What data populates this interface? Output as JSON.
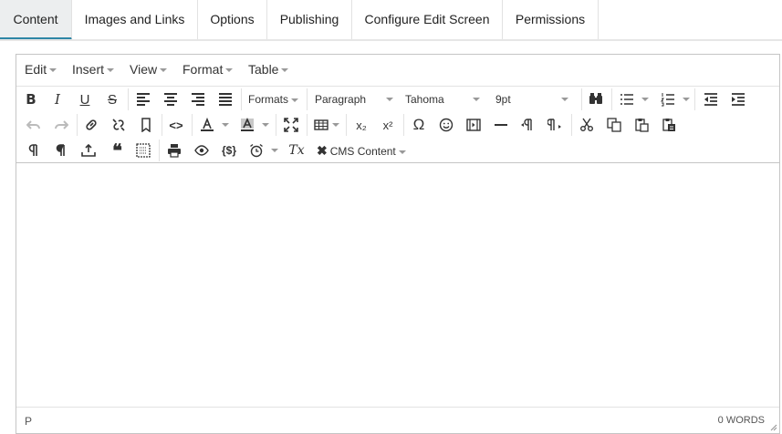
{
  "tabs": [
    {
      "label": "Content"
    },
    {
      "label": "Images and Links"
    },
    {
      "label": "Options"
    },
    {
      "label": "Publishing"
    },
    {
      "label": "Configure Edit Screen"
    },
    {
      "label": "Permissions"
    }
  ],
  "menubar": {
    "edit": "Edit",
    "insert": "Insert",
    "view": "View",
    "format": "Format",
    "table": "Table"
  },
  "toolbar": {
    "formats": "Formats",
    "paragraph": "Paragraph",
    "font": "Tahoma",
    "size": "9pt",
    "cms_content": "CMS Content",
    "bold": "B",
    "italic": "I",
    "underline": "U",
    "strike": "S",
    "omega": "Ω",
    "quote": "66",
    "source": "<>",
    "template": "{$}",
    "subscript": "x₂",
    "superscript": "x²",
    "clear_format": "Tx"
  },
  "statusbar": {
    "path": "P",
    "words": "0 WORDS"
  },
  "colors": {
    "tab_active_bg": "#eceeef",
    "tab_accent": "#2e86a6",
    "border": "#c5c5c5"
  }
}
